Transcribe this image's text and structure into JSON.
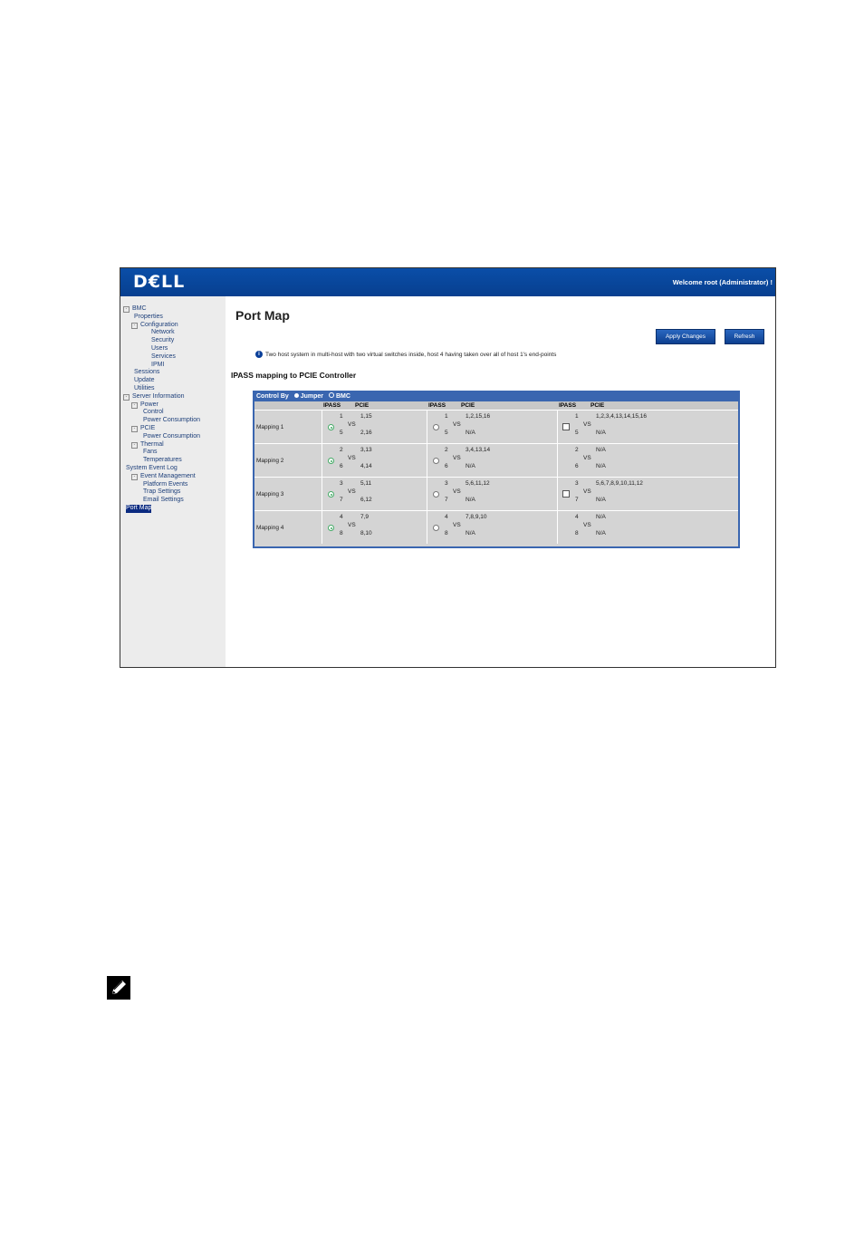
{
  "banner": {
    "logo": "D€LL",
    "welcome": "Welcome root (Administrator) !"
  },
  "sidebar": {
    "items": [
      {
        "label": "BMC",
        "level": 0,
        "expander": "-"
      },
      {
        "label": "Properties",
        "level": 1
      },
      {
        "label": "Configuration",
        "level": 1,
        "expander": "-"
      },
      {
        "label": "Network",
        "level": 3
      },
      {
        "label": "Security",
        "level": 3
      },
      {
        "label": "Users",
        "level": 3
      },
      {
        "label": "Services",
        "level": 3
      },
      {
        "label": "IPMI",
        "level": 3
      },
      {
        "label": "Sessions",
        "level": 1
      },
      {
        "label": "Update",
        "level": 1
      },
      {
        "label": "Utilities",
        "level": 1
      },
      {
        "label": "Server Information",
        "level": 0,
        "expander": "-"
      },
      {
        "label": "Power",
        "level": 1,
        "expander": "-"
      },
      {
        "label": "Control",
        "level": 2
      },
      {
        "label": "Power Consumption",
        "level": 2
      },
      {
        "label": "PCIE",
        "level": 1,
        "expander": "-"
      },
      {
        "label": "Power Consumption",
        "level": 2
      },
      {
        "label": "Thermal",
        "level": 1,
        "expander": "-"
      },
      {
        "label": "Fans",
        "level": 2
      },
      {
        "label": "Temperatures",
        "level": 2
      },
      {
        "label": "System Event Log",
        "level": 0
      },
      {
        "label": "Event Management",
        "level": 1,
        "expander": "-"
      },
      {
        "label": "Platform Events",
        "level": 2
      },
      {
        "label": "Trap Settings",
        "level": 2
      },
      {
        "label": "Email Settings",
        "level": 2
      },
      {
        "label": "Port Map",
        "level": 0,
        "selected": true
      }
    ]
  },
  "main": {
    "title": "Port Map",
    "apply_label": "Apply Changes",
    "refresh_label": "Refresh",
    "info_text": "Two host system in multi-host with two virtual switches inside, host 4 having taken over all of host 1's end-points",
    "section_title": "IPASS mapping to PCIE Controller",
    "control_by": "Control By",
    "control_opt1": "Jumper",
    "control_opt2": "BMC",
    "col_ipass": "IPASS",
    "col_pcie": "PCIE",
    "vs": "VS",
    "mappings": [
      {
        "label": "Mapping 1",
        "groups": [
          {
            "control": "radio-on",
            "a_ipass": "1",
            "a_pcie": "1,15",
            "b_ipass": "5",
            "b_pcie": "2,16"
          },
          {
            "control": "radio-off",
            "a_ipass": "1",
            "a_pcie": "1,2,15,16",
            "b_ipass": "5",
            "b_pcie": "N/A"
          },
          {
            "control": "checkbox",
            "a_ipass": "1",
            "a_pcie": "1,2,3,4,13,14,15,16",
            "b_ipass": "5",
            "b_pcie": "N/A"
          }
        ]
      },
      {
        "label": "Mapping 2",
        "groups": [
          {
            "control": "radio-on",
            "a_ipass": "2",
            "a_pcie": "3,13",
            "b_ipass": "6",
            "b_pcie": "4,14"
          },
          {
            "control": "radio-off",
            "a_ipass": "2",
            "a_pcie": "3,4,13,14",
            "b_ipass": "6",
            "b_pcie": "N/A"
          },
          {
            "control": "none",
            "a_ipass": "2",
            "a_pcie": "N/A",
            "b_ipass": "6",
            "b_pcie": "N/A"
          }
        ]
      },
      {
        "label": "Mapping 3",
        "groups": [
          {
            "control": "radio-on",
            "a_ipass": "3",
            "a_pcie": "5,11",
            "b_ipass": "7",
            "b_pcie": "6,12"
          },
          {
            "control": "radio-off",
            "a_ipass": "3",
            "a_pcie": "5,6,11,12",
            "b_ipass": "7",
            "b_pcie": "N/A"
          },
          {
            "control": "checkbox",
            "a_ipass": "3",
            "a_pcie": "5,6,7,8,9,10,11,12",
            "b_ipass": "7",
            "b_pcie": "N/A"
          }
        ]
      },
      {
        "label": "Mapping 4",
        "groups": [
          {
            "control": "radio-on",
            "a_ipass": "4",
            "a_pcie": "7,9",
            "b_ipass": "8",
            "b_pcie": "8,10"
          },
          {
            "control": "radio-off",
            "a_ipass": "4",
            "a_pcie": "7,8,9,10",
            "b_ipass": "8",
            "b_pcie": "N/A"
          },
          {
            "control": "none",
            "a_ipass": "4",
            "a_pcie": "N/A",
            "b_ipass": "8",
            "b_pcie": "N/A"
          }
        ]
      }
    ]
  },
  "note_icon": "pencil-note-icon"
}
